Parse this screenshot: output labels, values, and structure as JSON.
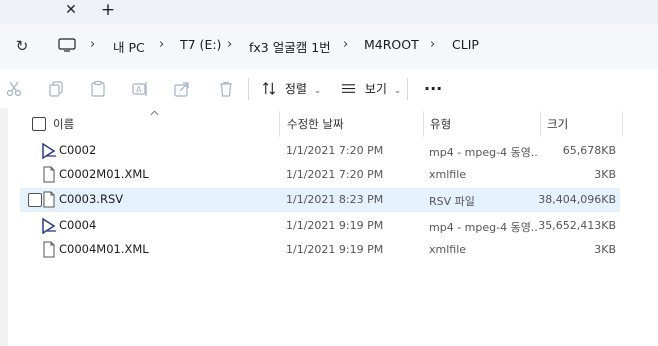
{
  "tabbar": {
    "close_glyph": "✕",
    "new_tab_glyph": "+"
  },
  "address": {
    "refresh_glyph": "↻",
    "separator": "›",
    "breadcrumbs": [
      "내 PC",
      "T7 (E:)",
      "fx3 얼굴캠 1번",
      "M4ROOT",
      "CLIP"
    ]
  },
  "toolbar": {
    "sort_label": "정렬",
    "view_label": "보기",
    "more_label": "···",
    "dropdown_glyph": "⌄"
  },
  "columns": {
    "name": "이름",
    "date": "수정한 날짜",
    "type": "유형",
    "size": "크기"
  },
  "files": [
    {
      "name": "C0002",
      "date": "1/1/2021 7:20 PM",
      "type": "mp4 - mpeg-4 동영...",
      "size": "65,678KB",
      "icon": "video-file-icon",
      "selected": false
    },
    {
      "name": "C0002M01.XML",
      "date": "1/1/2021 7:20 PM",
      "type": "xmlfile",
      "size": "3KB",
      "icon": "document-file-icon",
      "selected": false
    },
    {
      "name": "C0003.RSV",
      "date": "1/1/2021 8:23 PM",
      "type": "RSV 파일",
      "size": "38,404,096KB",
      "icon": "document-file-icon",
      "selected": true
    },
    {
      "name": "C0004",
      "date": "1/1/2021 9:19 PM",
      "type": "mp4 - mpeg-4 동영...",
      "size": "35,652,413KB",
      "icon": "video-file-icon",
      "selected": false
    },
    {
      "name": "C0004M01.XML",
      "date": "1/1/2021 9:19 PM",
      "type": "xmlfile",
      "size": "3KB",
      "icon": "document-file-icon",
      "selected": false
    }
  ],
  "colors": {
    "selection": "#e5f1fb",
    "accent": "#2b3a8f",
    "disabled_icon": "#a6b2c8"
  }
}
